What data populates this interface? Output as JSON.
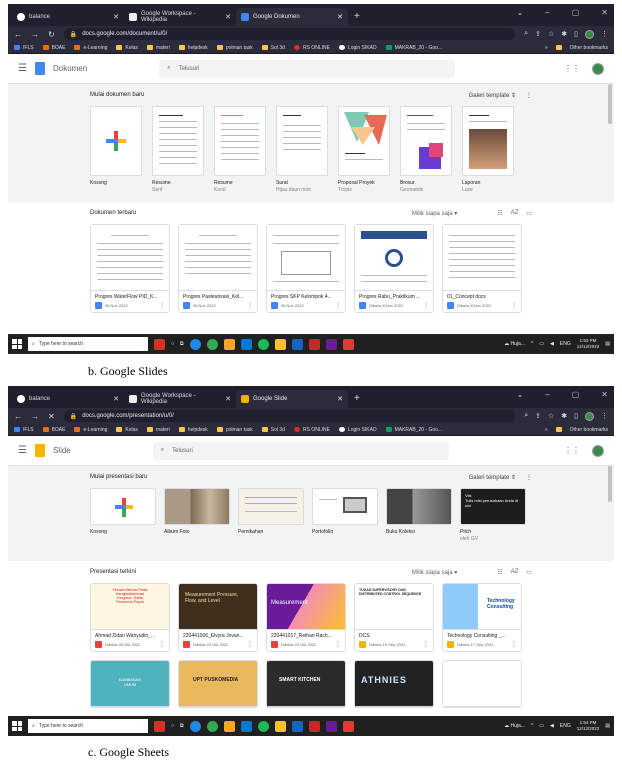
{
  "docs_shot": {
    "tabs": [
      {
        "label": "balance",
        "icon": "github-icon"
      },
      {
        "label": "Google Workspace - Wikipedia",
        "icon": "wikipedia-icon"
      },
      {
        "label": "Google Dokumen",
        "icon": "docs-icon"
      }
    ],
    "url": "docs.google.com/document/u/0/",
    "bookmarks": [
      "IFLS",
      "BOAE",
      "e-Learning",
      "Kelas",
      "materi",
      "helpdesk",
      "polman task",
      "Sol 3d",
      "RS ONLINE",
      "Login SIKAD",
      "MAKRAB_20 - Goo..."
    ],
    "other_bookmarks": "Other bookmarks",
    "app_name": "Dokumen",
    "search_placeholder": "Telusuri",
    "gallery_title": "Mulai dokumen baru",
    "gallery_template": "Galeri template",
    "templates": [
      {
        "name": "Kosong",
        "sub": ""
      },
      {
        "name": "Resume",
        "sub": "Serif"
      },
      {
        "name": "Resume",
        "sub": "Koral"
      },
      {
        "name": "Surat",
        "sub": "Hijau daun mint"
      },
      {
        "name": "Proposal Proyek",
        "sub": "Tropis"
      },
      {
        "name": "Brosur",
        "sub": "Geometrik"
      },
      {
        "name": "Laporan",
        "sub": "Luxe"
      }
    ],
    "recent_title": "Dokumen terbaru",
    "owner_filter": "Milik siapa saja",
    "recent": [
      {
        "name": "Progres WaterFlow PID_K...",
        "meta": "28 Nov 2022"
      },
      {
        "name": "Progres Pasteurisasi_Kel...",
        "meta": "28 Nov 2022"
      },
      {
        "name": "Progres SKP Kelompok 4...",
        "meta": "28 Nov 2022"
      },
      {
        "name": "Progres Rabu_Praktikum ...",
        "meta": "Dibuka 8 Nov 2022"
      },
      {
        "name": "01_Concept.docx",
        "meta": "Dibuka 8 Nov 2022"
      }
    ],
    "taskbar_search": "Type here to search",
    "weather": "Huja...",
    "lang": "ENG",
    "time": "1:53 PM",
    "date": "12/12/2022"
  },
  "caption_b": "b.   Google Slides",
  "slides_shot": {
    "tabs": [
      {
        "label": "balance",
        "icon": "github-icon"
      },
      {
        "label": "Google Workspace - Wikipedia",
        "icon": "wikipedia-icon"
      },
      {
        "label": "Google Slide",
        "icon": "slides-icon"
      }
    ],
    "url": "docs.google.com/presentation/u/0/",
    "app_name": "Slide",
    "search_placeholder": "Telusuri",
    "gallery_title": "Mulai presentasi baru",
    "gallery_template": "Galeri template",
    "templates": [
      {
        "name": "Kosong",
        "sub": ""
      },
      {
        "name": "Album Foto",
        "sub": ""
      },
      {
        "name": "Pernikahan",
        "sub": ""
      },
      {
        "name": "Portofolio",
        "sub": ""
      },
      {
        "name": "Buku Koleksi",
        "sub": ""
      },
      {
        "name": "Pitch",
        "sub": "oleh GV"
      }
    ],
    "pitch_text": "Visi\nTulis misi perusahaan Anda di sini",
    "recent_title": "Presentasi terkini",
    "owner_filter": "Milik siapa saja",
    "recent": [
      {
        "name": "Ahmad Zidan Wahyudin_...",
        "meta": "Dibuka 26 Okt 2022",
        "thumb": "Sebuah Aktivasi Fisika Mengkarakterisasi Pengaruh Teknik Pemberian Pupuk"
      },
      {
        "name": "220441006_Elvyra Jovan...",
        "meta": "Dibuka 23 Okt 2022",
        "thumb": "Measurement Pressure, Flow, and Level"
      },
      {
        "name": "220441017_Reihan Rach...",
        "meta": "Dibuka 23 Okt 2022",
        "thumb": "Measurement"
      },
      {
        "name": "DCS",
        "meta": "Dibuka 19 Sep 2022",
        "thumb": "TUGAS SUPERVISORY DAN DISTRIBUTED CONTROL SEQUENCE"
      },
      {
        "name": "Technology Consulting _...",
        "meta": "Dibuka 17 Sep 2022",
        "thumb": "Technology Consulting"
      }
    ],
    "row2": [
      "KAMBASAN UMUM",
      "UPT PUSKOMEDIA",
      "SMART KITCHEN",
      "ATHNIES",
      ""
    ],
    "time": "1:54 PM",
    "date": "12/12/2022"
  },
  "caption_c": "c.   Google Sheets",
  "colors": {
    "docs_blue": "#4285f4",
    "slides_yellow": "#f4b400"
  }
}
